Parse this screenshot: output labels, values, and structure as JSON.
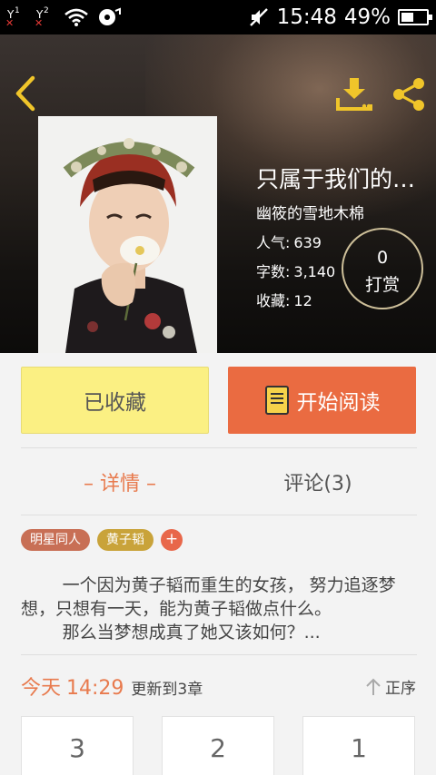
{
  "status_bar": {
    "sim1_label": "1",
    "sim2_label": "2",
    "time": "15:48",
    "battery": "49%",
    "battery_level": 0.49
  },
  "header": {
    "title": "只属于我们的…",
    "author": "幽筱的雪地木棉",
    "popularity_label": "人气:",
    "popularity_value": "639",
    "words_label": "字数:",
    "words_value": "3,140",
    "favorites_label": "收藏:",
    "favorites_value": "12",
    "tip_count": "0",
    "tip_label": "打赏"
  },
  "actions": {
    "collect_label": "已收藏",
    "read_label": "开始阅读"
  },
  "tabs": [
    {
      "label": "– 详情 –"
    },
    {
      "label": "评论(3)"
    }
  ],
  "tags": [
    {
      "label": "明星同人"
    },
    {
      "label": "黄子韬"
    }
  ],
  "tag_add": "+",
  "description": {
    "para1": "一个因为黄子韬而重生的女孩， 努力追逐梦想，只想有一天，能为黄子韬做点什么。",
    "para2": "那么当梦想成真了她又该如何？..."
  },
  "update": {
    "today": "今天",
    "time": "14:29",
    "info": "更新到3章",
    "sort_label": "正序"
  },
  "chapters": [
    "3",
    "2",
    "1"
  ],
  "colors": {
    "accent_orange": "#ea6b41",
    "collect_yellow": "#fbf083"
  }
}
